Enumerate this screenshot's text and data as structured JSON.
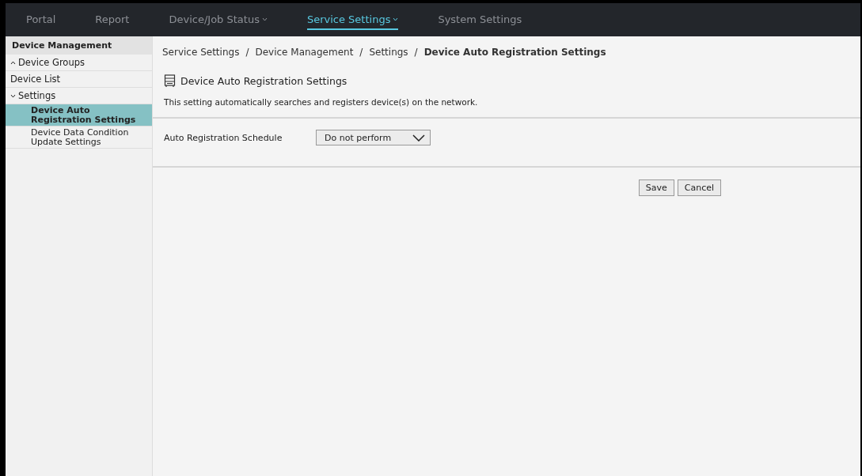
{
  "nav": {
    "tabs": [
      {
        "label": "Portal",
        "selected": false,
        "dropdown": false
      },
      {
        "label": "Report",
        "selected": false,
        "dropdown": false
      },
      {
        "label": "Device/Job Status",
        "selected": false,
        "dropdown": true
      },
      {
        "label": "Service Settings",
        "selected": true,
        "dropdown": true
      },
      {
        "label": "System Settings",
        "selected": false,
        "dropdown": false
      }
    ]
  },
  "sidebar": {
    "title": "Device Management",
    "items": [
      {
        "label": "Device Groups",
        "expanded": false,
        "selected": false
      },
      {
        "label": "Device List",
        "selected": false
      },
      {
        "label": "Settings",
        "expanded": true,
        "selected": false,
        "children": [
          {
            "label": "Device Auto Registration Settings",
            "selected": true
          },
          {
            "label": "Device Data Condition Update Settings",
            "selected": false
          }
        ]
      }
    ]
  },
  "breadcrumb": [
    {
      "label": "Service Settings",
      "separator": "/"
    },
    {
      "label": "Device Management",
      "separator": "/"
    },
    {
      "label": "Settings",
      "separator": "/"
    }
  ],
  "breadcrumb_current": "Device Auto Registration Settings",
  "page": {
    "title": "Device Auto Registration Settings",
    "description": "This setting automatically searches and registers device(s) on the network."
  },
  "form": {
    "label": "Auto Registration Schedule",
    "value": "Do not perform"
  },
  "buttons": [
    "Save",
    "Cancel"
  ]
}
